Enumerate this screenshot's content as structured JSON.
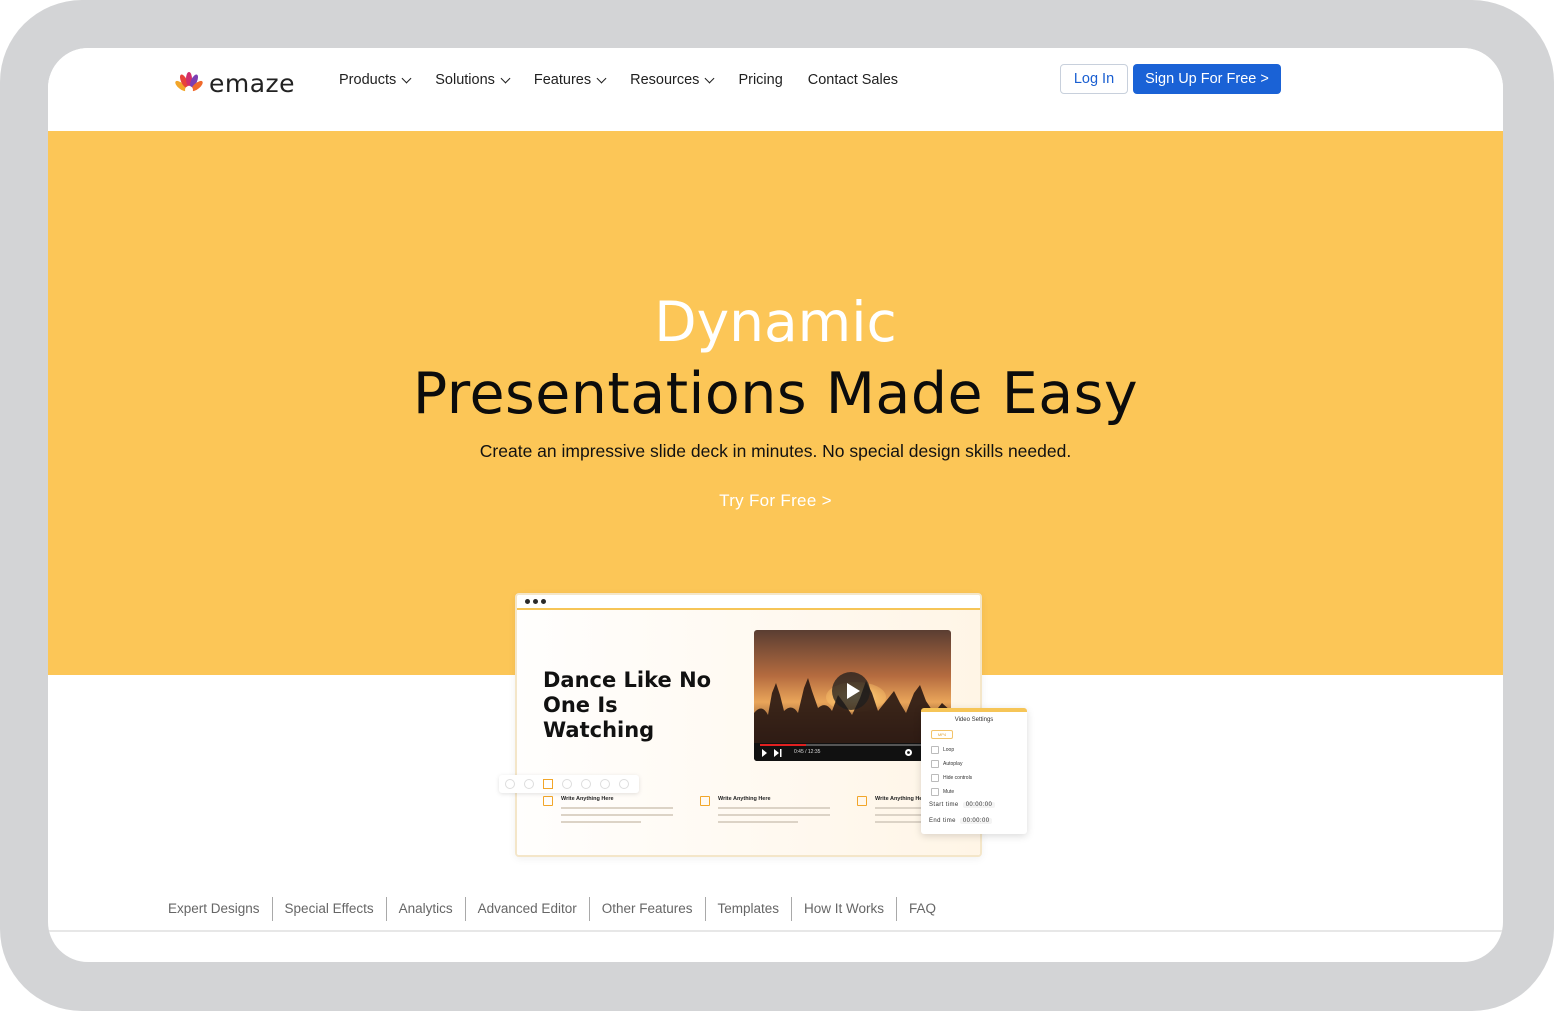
{
  "brand": {
    "name": "emaze",
    "logo_icon": "peacock-fan-logo"
  },
  "nav": {
    "items": [
      {
        "label": "Products",
        "has_dropdown": true
      },
      {
        "label": "Solutions",
        "has_dropdown": true
      },
      {
        "label": "Features",
        "has_dropdown": true
      },
      {
        "label": "Resources",
        "has_dropdown": true
      },
      {
        "label": "Pricing",
        "has_dropdown": false
      },
      {
        "label": "Contact Sales",
        "has_dropdown": false
      }
    ],
    "login_label": "Log In",
    "signup_label": "Sign Up For Free >"
  },
  "hero": {
    "kicker": "Dynamic",
    "headline": "Presentations Made Easy",
    "subtitle": "Create an impressive slide deck in minutes. No special design skills needed.",
    "cta": "Try For Free >",
    "background_color": "#fcc657"
  },
  "mockup": {
    "slide_title": "Dance Like No One Is Watching",
    "video_time": "0:45 / 12:35",
    "video_progress": 0.25,
    "feature_title": "Write Anything Here",
    "settings": {
      "title": "Video Settings",
      "tag": "MP4",
      "options": [
        "Loop",
        "Autoplay",
        "Hide controls",
        "Mute"
      ],
      "start_label": "Start time",
      "start_value": "00:00:00",
      "end_label": "End time",
      "end_value": "00:00:00"
    }
  },
  "subnav": {
    "items": [
      "Expert Designs",
      "Special Effects",
      "Analytics",
      "Advanced Editor",
      "Other Features",
      "Templates",
      "How It Works",
      "FAQ"
    ]
  },
  "colors": {
    "accent": "#1a62d6",
    "hero": "#fcc657",
    "frame": "#d3d4d6"
  }
}
